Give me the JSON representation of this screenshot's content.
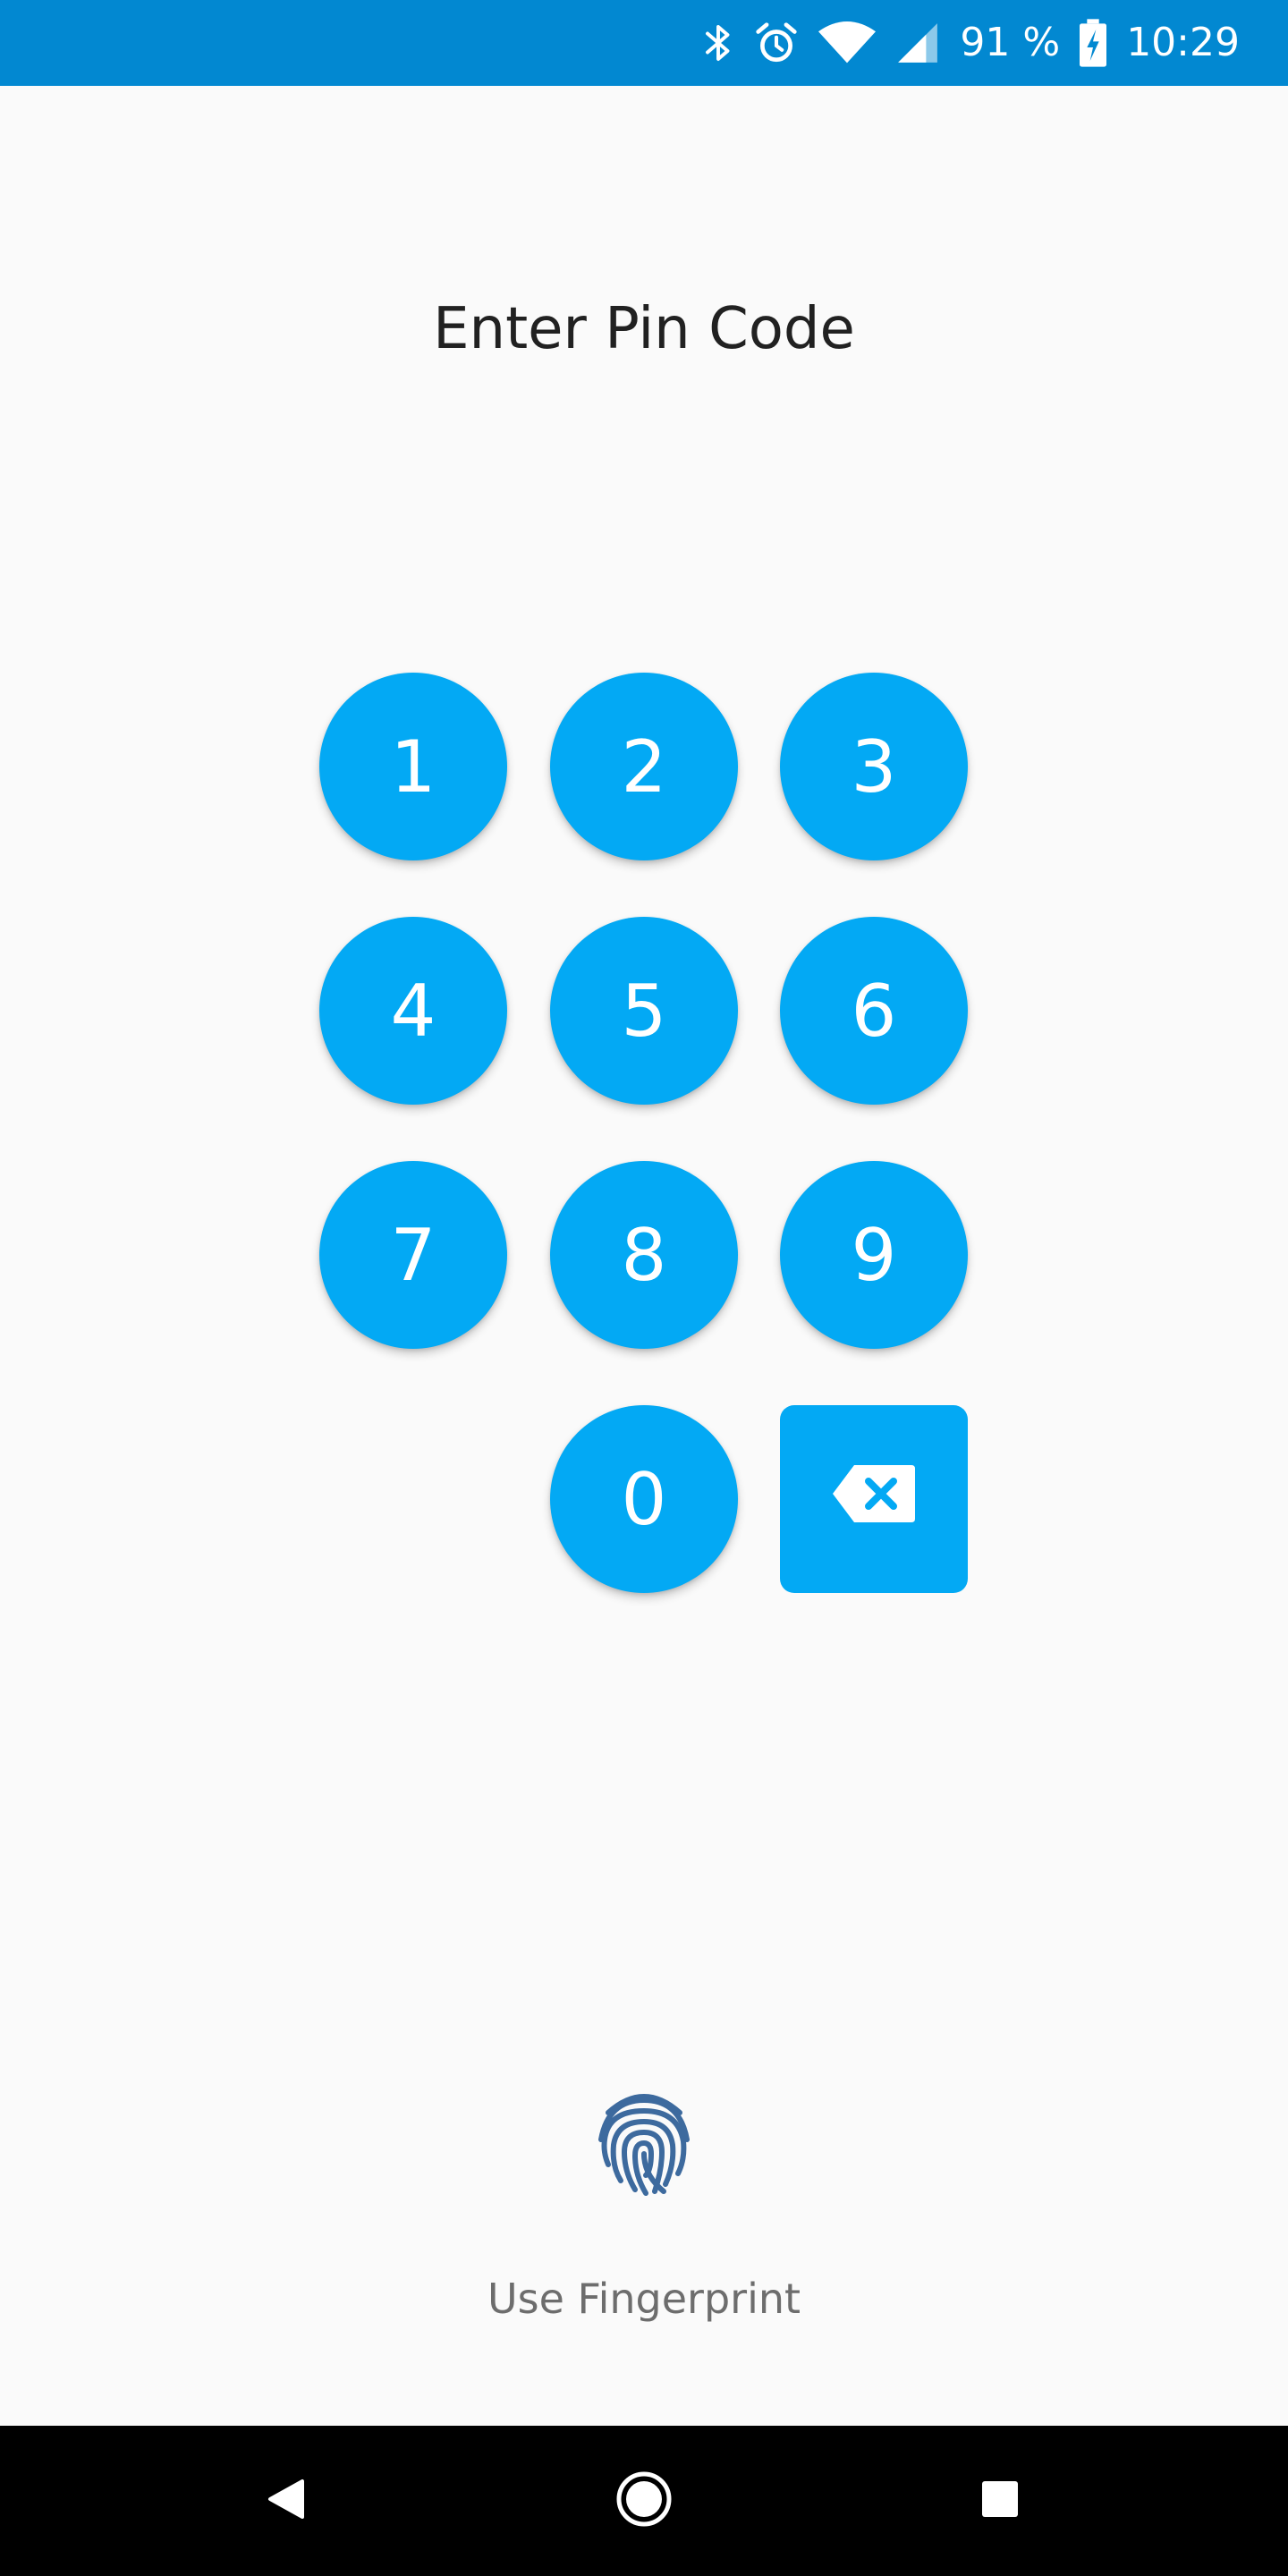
{
  "status_bar": {
    "battery_text": "91 %",
    "time": "10:29",
    "icons": [
      "bluetooth-icon",
      "alarm-icon",
      "wifi-icon",
      "cell-signal-icon",
      "battery-charging-icon"
    ],
    "background_color": "#0288d1"
  },
  "header": {
    "title": "Enter Pin Code"
  },
  "keypad": {
    "accent_color": "#03a9f4",
    "keys": [
      "1",
      "2",
      "3",
      "4",
      "5",
      "6",
      "7",
      "8",
      "9",
      "0"
    ],
    "backspace_icon": "backspace-icon"
  },
  "fingerprint": {
    "icon": "fingerprint-icon",
    "label": "Use Fingerprint",
    "icon_color": "#3d6a9e"
  },
  "nav_bar": {
    "icons": [
      "back-triangle-icon",
      "home-circle-icon",
      "recents-square-icon"
    ]
  }
}
